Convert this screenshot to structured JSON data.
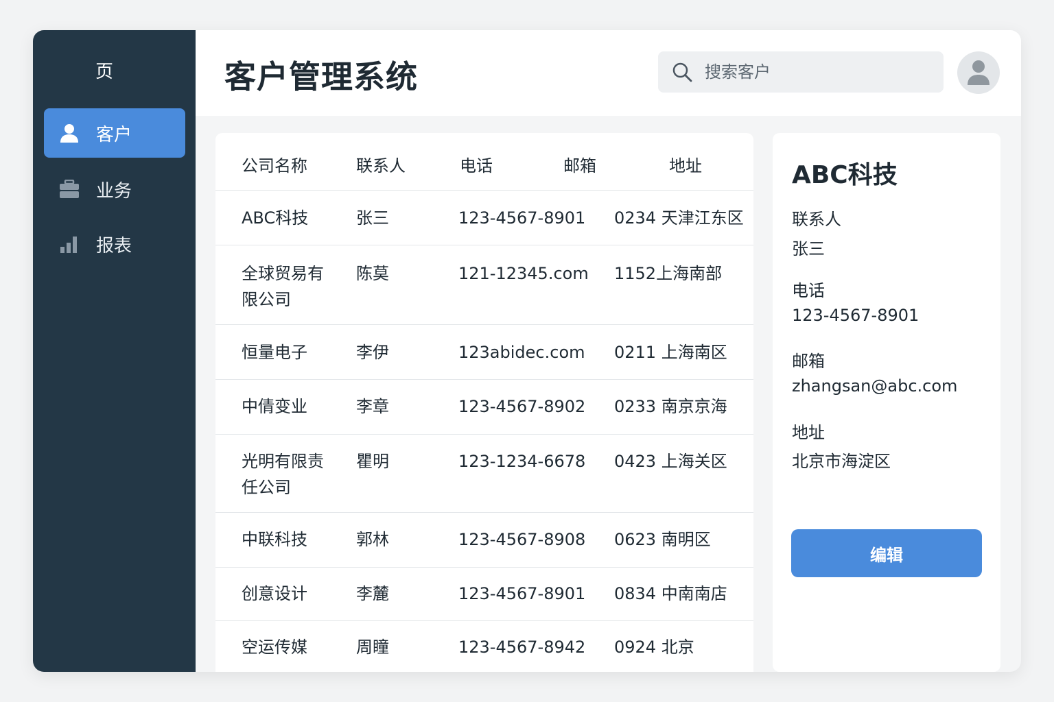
{
  "sidebar": {
    "logo": "页",
    "items": [
      {
        "label": "客户",
        "icon": "user-icon",
        "active": true
      },
      {
        "label": "业务",
        "icon": "briefcase-icon",
        "active": false
      },
      {
        "label": "报表",
        "icon": "bar-chart-icon",
        "active": false
      }
    ]
  },
  "header": {
    "title": "客户管理系统",
    "search_placeholder": "搜索客户"
  },
  "table": {
    "columns": [
      "公司名称",
      "联系人",
      "电话",
      "邮箱",
      "地址"
    ],
    "rows": [
      {
        "name": "ABC科技",
        "contact": "张三",
        "phone": "123-4567-8901",
        "address": "0234 天津江东区"
      },
      {
        "name": "全球贸易有限公司",
        "contact": "陈莫",
        "phone": "121-12345.com",
        "address": "1152上海南部"
      },
      {
        "name": "恒量电子",
        "contact": "李伊",
        "phone": "123abidec.com",
        "address": "0211 上海南区"
      },
      {
        "name": "中倩变业",
        "contact": "李章",
        "phone": "123-4567-8902",
        "address": "0233 南京京海"
      },
      {
        "name": "光明有限责任公司",
        "contact": "瞿明",
        "phone": "123-1234-6678",
        "address": "0423 上海关区"
      },
      {
        "name": "中联科技",
        "contact": "郭林",
        "phone": "123-4567-8908",
        "address": "0623 南明区"
      },
      {
        "name": "创意设计",
        "contact": "李麓",
        "phone": "123-4567-8901",
        "address": "0834 中南南店"
      },
      {
        "name": "空运传媒",
        "contact": "周瞳",
        "phone": "123-4567-8942",
        "address": "0924 北京"
      }
    ]
  },
  "detail": {
    "title": "ABC科技",
    "contact_label": "联系人",
    "contact_value": "张三",
    "phone_label": "电话",
    "phone_value": "123-4567-8901",
    "email_label": "邮箱",
    "email_value": "zhangsan@abc.com",
    "address_label": "地址",
    "address_value": "北京市海淀区",
    "edit_label": "编辑"
  },
  "colors": {
    "sidebar_bg": "#233746",
    "accent": "#4a8bdc"
  }
}
